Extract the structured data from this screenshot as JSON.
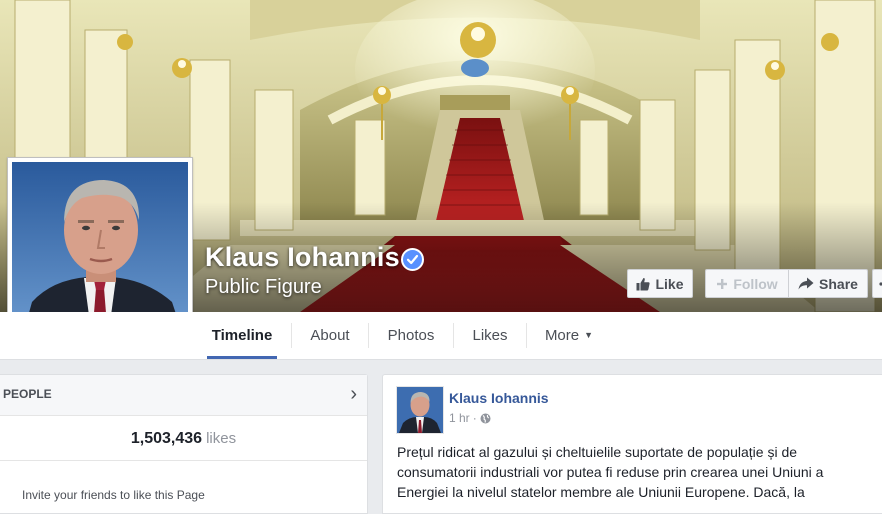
{
  "page": {
    "name": "Klaus Iohannis",
    "category": "Public Figure"
  },
  "actions": {
    "like_label": "Like",
    "follow_label": "Follow",
    "share_label": "Share"
  },
  "tabs": [
    {
      "label": "Timeline",
      "active": true
    },
    {
      "label": "About",
      "active": false
    },
    {
      "label": "Photos",
      "active": false
    },
    {
      "label": "Likes",
      "active": false
    },
    {
      "label": "More",
      "active": false
    }
  ],
  "people_card": {
    "header": "PEOPLE",
    "likes_count": "1,503,436",
    "likes_label": "likes",
    "invite_text": "Invite your friends to like this Page"
  },
  "post": {
    "author": "Klaus Iohannis",
    "time": "1 hr",
    "separator": "·",
    "text": "Prețul ridicat al gazului și cheltuielile suportate de populație și de consumatorii industriali vor putea fi reduse prin crearea unei Uniuni a Energiei la nivelul statelor membre ale Uniunii Europene. Dacă, la"
  },
  "colors": {
    "accent": "#4267b2",
    "link": "#365899",
    "verified": "#5890ff",
    "carpet": "#b01e1e"
  },
  "icons": {
    "verified": "verified-badge-icon",
    "like": "thumbs-up-icon",
    "follow": "plus-icon",
    "share": "share-arrow-icon",
    "chevron": "chevron-right-icon",
    "privacy": "globe-icon"
  }
}
